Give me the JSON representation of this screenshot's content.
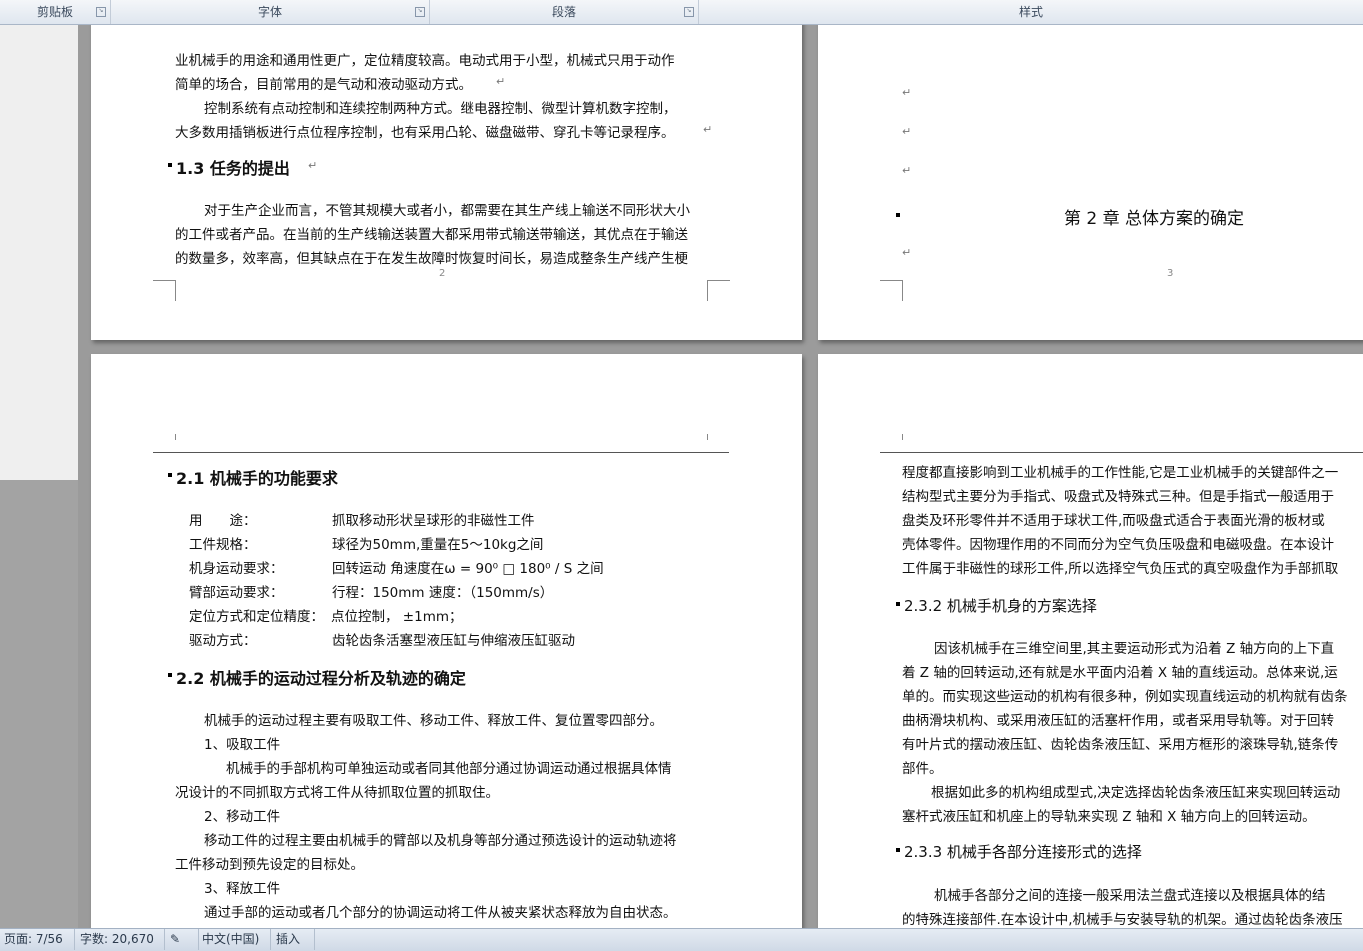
{
  "ribbon": {
    "groups": [
      {
        "label": "剪贴板"
      },
      {
        "label": "字体"
      },
      {
        "label": "段落"
      },
      {
        "label": "样式"
      }
    ]
  },
  "page_top_left": {
    "lines": [
      "业机械手的用途和通用性更广，定位精度较高。电动式用于小型，机械式只用于动作",
      "简单的场合，目前常用的是气动和液动驱动方式。",
      "控制系统有点动控制和连续控制两种方式。继电器控制、微型计算机数字控制，",
      "大多数用插销板进行点位程序控制，也有采用凸轮、磁盘磁带、穿孔卡等记录程序。"
    ],
    "heading": "1.3 任务的提出",
    "para": [
      "对于生产企业而言，不管其规模大或者小，都需要在其生产线上输送不同形状大小",
      "的工件或者产品。在当前的生产线输送装置大都采用带式输送带输送，其优点在于输送",
      "的数量多，效率高，但其缺点在于在发生故障时恢复时间长，易造成整条生产线产生梗"
    ],
    "page_number": "2"
  },
  "page_top_right": {
    "chapter_title": "第 2 章  总体方案的确定",
    "page_number": "3"
  },
  "page_bottom_left": {
    "heading1": "2.1 机械手的功能要求",
    "spec_rows": [
      {
        "label": "用　　途：",
        "value": "抓取移动形状呈球形的非磁性工件"
      },
      {
        "label": "工件规格：",
        "value": "球径为50mm,重量在5～10kg之间"
      },
      {
        "label": "机身运动要求：",
        "value": "回转运动  角速度在ω = 90⁰ □ 180⁰ / S 之间"
      },
      {
        "label": "臂部运动要求：",
        "value": "行程：150mm   速度：（150mm/s）"
      },
      {
        "label": "定位方式和定位精度：",
        "value": "点位控制，  ±1mm；"
      },
      {
        "label": "驱动方式：",
        "value": "齿轮齿条活塞型液压缸与伸缩液压缸驱动"
      }
    ],
    "heading2": "2.2 机械手的运动过程分析及轨迹的确定",
    "body": [
      "机械手的运动过程主要有吸取工件、移动工件、释放工件、复位置零四部分。",
      "1、吸取工件",
      "机械手的手部机构可单独运动或者同其他部分通过协调运动通过根据具体情",
      "况设计的不同抓取方式将工件从待抓取位置的抓取住。",
      "2、移动工件",
      "移动工件的过程主要由机械手的臂部以及机身等部分通过预选设计的运动轨迹将",
      "工件移动到预先设定的目标处。",
      "3、释放工件",
      "通过手部的运动或者几个部分的协调运动将工件从被夹紧状态释放为自由状态。"
    ]
  },
  "page_bottom_right": {
    "para1": [
      "程度都直接影响到工业机械手的工作性能,它是工业机械手的关键部件之一",
      "结构型式主要分为手指式、吸盘式及特殊式三种。但是手指式一般适用于",
      "盘类及环形零件并不适用于球状工件,而吸盘式适合于表面光滑的板材或",
      "壳体零件。因物理作用的不同而分为空气负压吸盘和电磁吸盘。在本设计",
      "工件属于非磁性的球形工件,所以选择空气负压式的真空吸盘作为手部抓取"
    ],
    "heading1": "2.3.2 机械手机身的方案选择",
    "para2": [
      "因该机械手在三维空间里,其主要运动形式为沿着  Z 轴方向的上下直",
      "着 Z 轴的回转运动,还有就是水平面内沿着 X 轴的直线运动。总体来说,运",
      "单的。而实现这些运动的机构有很多种，例如实现直线运动的机构就有齿条",
      "曲柄滑块机构、或采用液压缸的活塞杆作用，或者采用导轨等。对于回转",
      "有叶片式的摆动液压缸、齿轮齿条液压缸、采用方框形的滚珠导轨,链条传",
      "部件。",
      "根据如此多的机构组成型式,决定选择齿轮齿条液压缸来实现回转运动",
      "塞杆式液压缸和机座上的导轨来实现 Z 轴和 X 轴方向上的回转运动。"
    ],
    "heading2": "2.3.3 机械手各部分连接形式的选择",
    "para3": [
      "机械手各部分之间的连接一般采用法兰盘式连接以及根据具体的结",
      "的特殊连接部件.在本设计中,机械手与安装导轨的机架。通过齿轮齿条液压"
    ]
  },
  "status": {
    "page": "页面: 7/56",
    "words": "字数: 20,670",
    "lang": "中文(中国)",
    "mode": "插入"
  }
}
